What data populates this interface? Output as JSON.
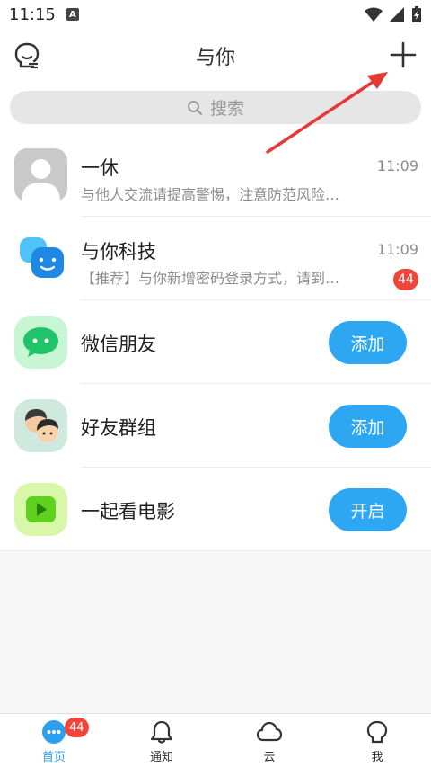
{
  "status": {
    "time": "11:15",
    "notice": "A"
  },
  "header": {
    "title": "与你"
  },
  "search": {
    "placeholder": "搜索"
  },
  "conversations": [
    {
      "title": "一休",
      "time": "11:09",
      "subtitle": "与他人交流请提高警惕，注意防范风险…"
    },
    {
      "title": "与你科技",
      "time": "11:09",
      "subtitle": "【推荐】与你新增密码登录方式，请到…",
      "badge": "44"
    }
  ],
  "features": [
    {
      "title": "微信朋友",
      "action": "添加"
    },
    {
      "title": "好友群组",
      "action": "添加"
    },
    {
      "title": "一起看电影",
      "action": "开启"
    }
  ],
  "tabs": [
    {
      "label": "首页",
      "badge": "44"
    },
    {
      "label": "通知"
    },
    {
      "label": "云"
    },
    {
      "label": "我"
    }
  ],
  "colors": {
    "accent": "#2ea7f2",
    "badge": "#f0453a",
    "arrow": "#e53935"
  }
}
